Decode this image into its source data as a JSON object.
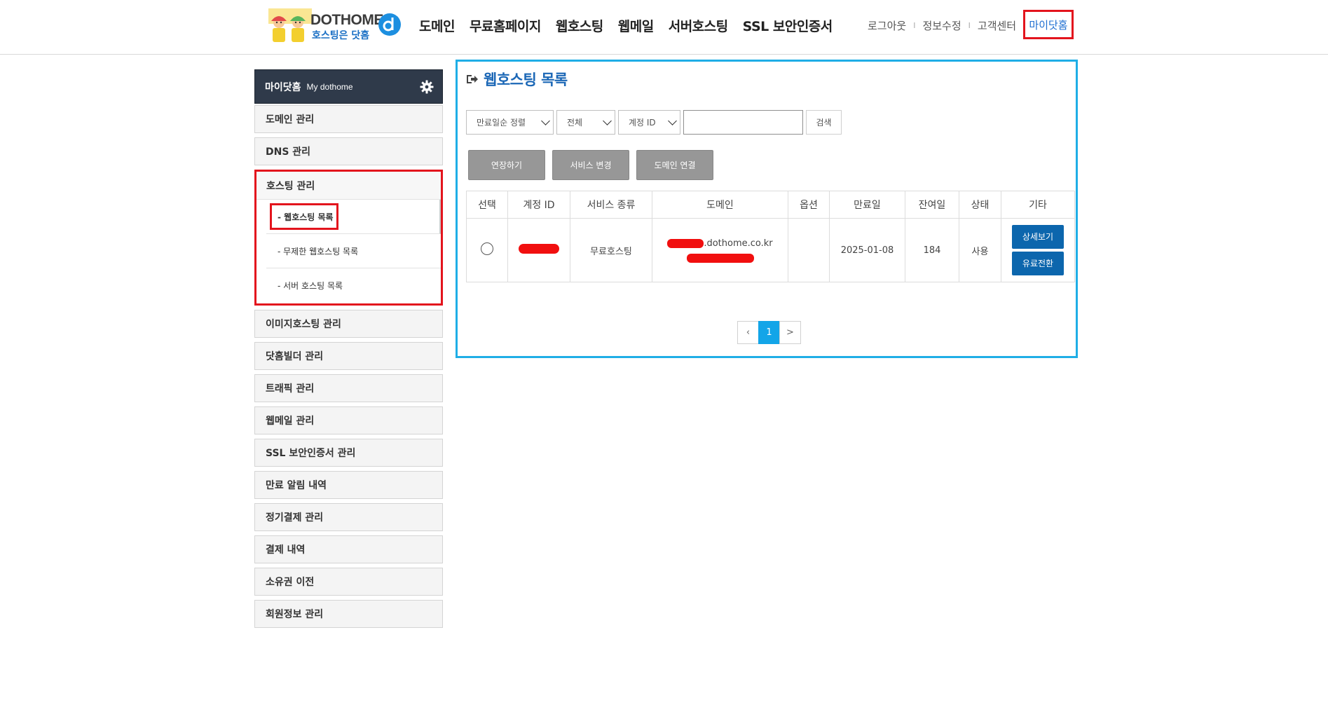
{
  "header": {
    "logo_brand": "DOTHOME",
    "logo_slogan": "호스팅은 닷홈",
    "nav": [
      "도메인",
      "무료홈페이지",
      "웹호스팅",
      "웹메일",
      "서버호스팅",
      "SSL 보안인증서"
    ],
    "util": [
      "로그아웃",
      "정보수정",
      "고객센터"
    ],
    "util_separator": "I",
    "mydothome": "마이닷홈",
    "highlight_color": "#e3141d"
  },
  "sidebar": {
    "title": "마이닷홈",
    "subtitle": "My dothome",
    "items_top": [
      "도메인 관리",
      "DNS 관리"
    ],
    "hosting_group": {
      "title": "호스팅 관리",
      "subitems": [
        "- 웹호스팅 목록",
        "- 무제한 웹호스팅 목록",
        "- 서버 호스팅 목록"
      ]
    },
    "items_bottom": [
      "이미지호스팅 관리",
      "닷홈빌더 관리",
      "트래픽 관리",
      "웹메일 관리",
      "SSL 보안인증서 관리",
      "만료 알림 내역",
      "정기결제 관리",
      "결제 내역",
      "소유권 이전",
      "회원정보 관리"
    ]
  },
  "main": {
    "title": "웹호스팅 목록",
    "border_color": "#1faee6",
    "filters": {
      "sort": "만료일순 정렬",
      "type": "전체",
      "field": "계정 ID",
      "search_value": "",
      "search_button": "검색"
    },
    "actions": [
      "연장하기",
      "서비스 변경",
      "도메인 연결"
    ],
    "table": {
      "headers": [
        "선택",
        "계정 ID",
        "서비스 종류",
        "도메인",
        "옵션",
        "만료일",
        "잔여일",
        "상태",
        "기타"
      ],
      "rows": [
        {
          "service_type": "무료호스팅",
          "domain_suffix": ".dothome.co.kr",
          "option": "",
          "expiry": "2025-01-08",
          "remaining": "184",
          "status": "사용",
          "buttons": [
            "상세보기",
            "유료전환"
          ]
        }
      ]
    },
    "pagination": {
      "prev": "‹",
      "current": "1",
      "next": ">"
    }
  }
}
